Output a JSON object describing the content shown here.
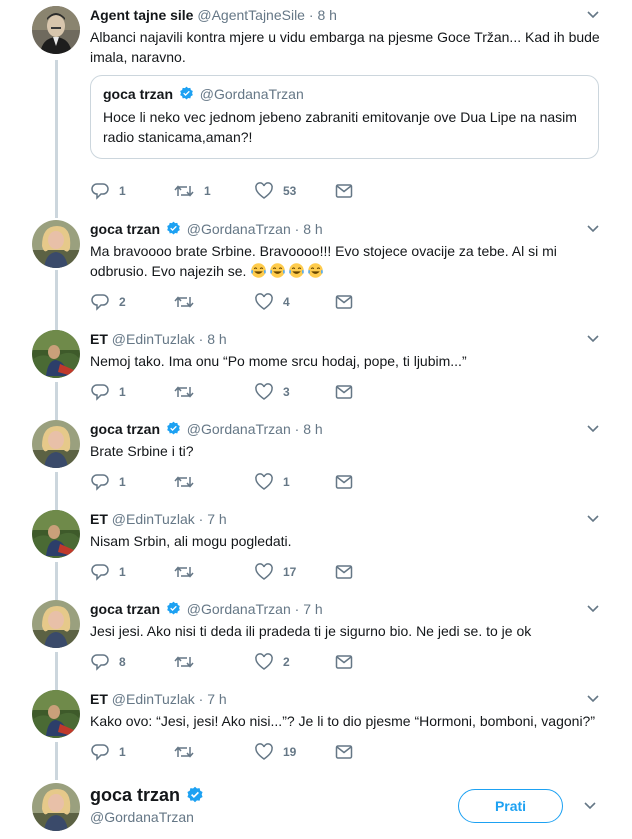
{
  "tweets": [
    {
      "name": "Agent tajne sile",
      "handle": "@AgentTajneSile",
      "time": "8 h",
      "verified": false,
      "text": "Albanci najavili kontra mjere u vidu embarga na pjesme Goce Tržan... Kad ih bude imala, naravno.",
      "quote": {
        "name": "goca trzan",
        "handle": "@GordanaTrzan",
        "text": "Hoce li neko vec jednom jebeno zabraniti emitovanje ove Dua Lipe na nasim radio stanicama,aman?!"
      },
      "replies": "1",
      "retweets": "1",
      "likes": "53"
    },
    {
      "name": "goca trzan",
      "handle": "@GordanaTrzan",
      "time": "8 h",
      "verified": true,
      "text": "Ma bravoooo brate Srbine. Bravoooo!!! Evo stojece ovacije za tebe. Al si mi odbrusio. Evo najezih se.",
      "emoji": "tears-of-joy x4",
      "replies": "2",
      "retweets": "",
      "likes": "4"
    },
    {
      "name": "ET",
      "handle": "@EdinTuzlak",
      "time": "8 h",
      "verified": false,
      "text": "Nemoj tako. Ima onu “Po mome srcu hodaj, pope, ti ljubim...”",
      "replies": "1",
      "retweets": "",
      "likes": "3"
    },
    {
      "name": "goca trzan",
      "handle": "@GordanaTrzan",
      "time": "8 h",
      "verified": true,
      "text": "Brate Srbine i ti?",
      "replies": "1",
      "retweets": "",
      "likes": "1"
    },
    {
      "name": "ET",
      "handle": "@EdinTuzlak",
      "time": "7 h",
      "verified": false,
      "text": "Nisam Srbin, ali mogu pogledati.",
      "replies": "1",
      "retweets": "",
      "likes": "17"
    },
    {
      "name": "goca trzan",
      "handle": "@GordanaTrzan",
      "time": "7 h",
      "verified": true,
      "text": "Jesi jesi. Ako nisi ti deda ili pradeda ti je sigurno bio. Ne jedi se. to je ok",
      "replies": "8",
      "retweets": "",
      "likes": "2"
    },
    {
      "name": "ET",
      "handle": "@EdinTuzlak",
      "time": "7 h",
      "verified": false,
      "text": "Kako ovo: “Jesi, jesi! Ako nisi...”? Je li to dio pjesme “Hormoni, bomboni, vagoni?”",
      "replies": "1",
      "retweets": "",
      "likes": "19"
    }
  ],
  "footer": {
    "name": "goca trzan",
    "handle": "@GordanaTrzan",
    "follow_label": "Prati"
  },
  "colors": {
    "text": "#14171a",
    "muted": "#657786",
    "accent": "#1da1f2",
    "border": "#ccd6dd"
  },
  "icons": [
    "reply-icon",
    "retweet-icon",
    "like-icon",
    "direct-message-icon",
    "verified-badge-icon",
    "chevron-down-icon"
  ]
}
